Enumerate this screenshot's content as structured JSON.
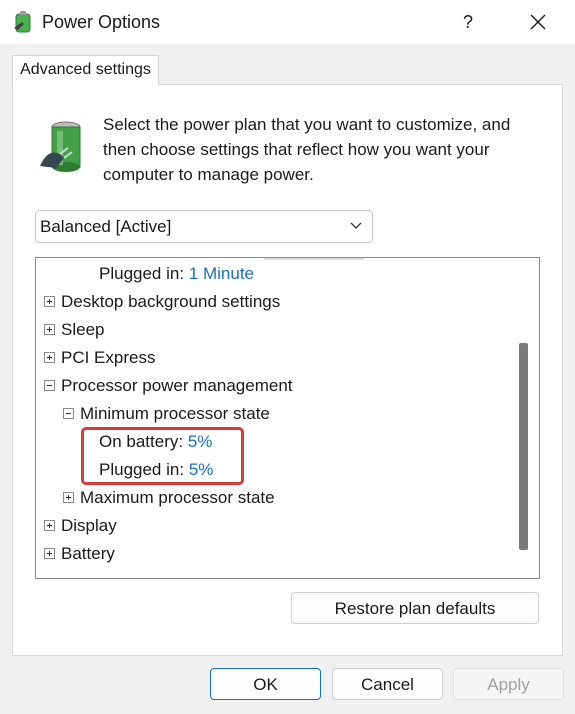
{
  "window": {
    "title": "Power Options",
    "help_label": "?"
  },
  "tabs": [
    {
      "label": "Advanced settings"
    }
  ],
  "description": "Select the power plan that you want to customize, and then choose settings that reflect how you want your computer to manage power.",
  "plan_select": {
    "selected": "Balanced [Active]"
  },
  "tree": {
    "rows": [
      {
        "label": "Plugged in:",
        "value": "1 Minute"
      },
      {
        "label": "Desktop background settings"
      },
      {
        "label": "Sleep"
      },
      {
        "label": "PCI Express"
      },
      {
        "label": "Processor power management"
      },
      {
        "label": "Minimum processor state"
      },
      {
        "label": "On battery:",
        "value": "5%"
      },
      {
        "label": "Plugged in:",
        "value": "5%"
      },
      {
        "label": "Maximum processor state"
      },
      {
        "label": "Display"
      },
      {
        "label": "Battery"
      }
    ]
  },
  "buttons": {
    "restore": "Restore plan defaults",
    "ok": "OK",
    "cancel": "Cancel",
    "apply": "Apply"
  },
  "icons": {
    "app": "battery-plug-icon",
    "help": "help-icon",
    "close": "close-icon",
    "dropdown": "chevron-down-icon"
  },
  "colors": {
    "highlight": "#d83a3a",
    "link_value": "#1a6fc4",
    "primary_border": "#1a6fc4"
  }
}
